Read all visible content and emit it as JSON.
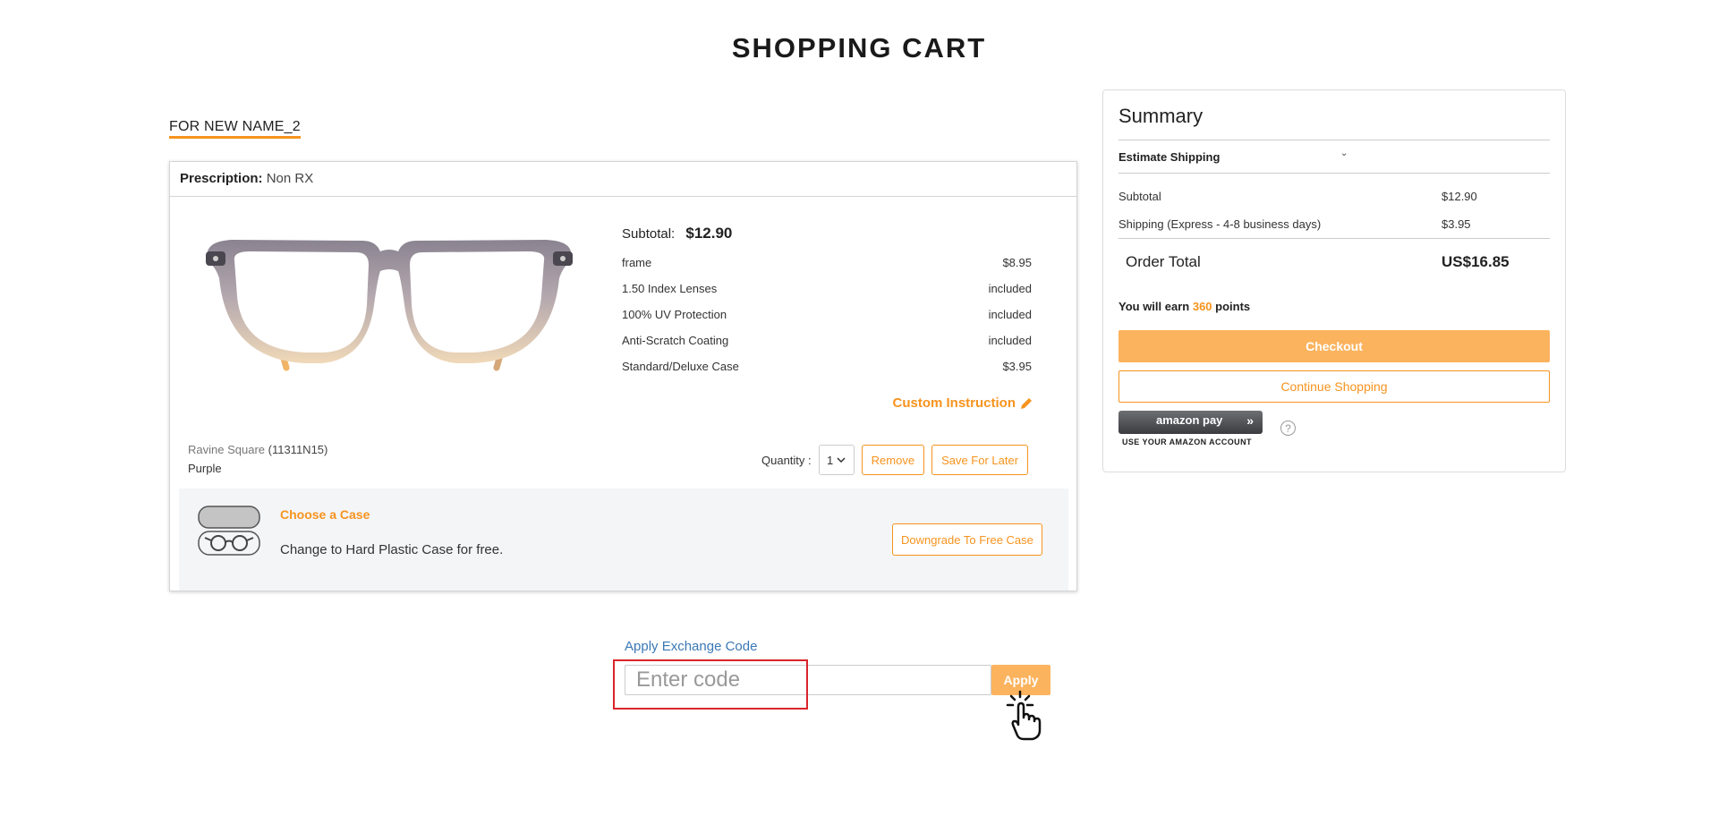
{
  "page": {
    "title": "SHOPPING CART"
  },
  "recipient": "FOR NEW NAME_2",
  "item": {
    "prescription_label": "Prescription:",
    "prescription_value": "Non RX",
    "name": "Ravine Square",
    "sku": "(11311N15)",
    "color": "Purple",
    "subtotal_label": "Subtotal:",
    "subtotal_value": "$12.90",
    "lines": [
      {
        "label": "frame",
        "value": "$8.95"
      },
      {
        "label": "1.50 Index Lenses",
        "value": "included"
      },
      {
        "label": "100% UV Protection",
        "value": "included"
      },
      {
        "label": "Anti-Scratch Coating",
        "value": "included"
      },
      {
        "label": "Standard/Deluxe Case",
        "value": "$3.95"
      }
    ],
    "custom_instruction": "Custom Instruction",
    "quantity_label": "Quantity :",
    "quantity_value": "1",
    "remove_label": "Remove",
    "save_later_label": "Save For Later"
  },
  "case": {
    "title": "Choose a Case",
    "description": "Change to Hard Plastic Case for free.",
    "button": "Downgrade To Free Case"
  },
  "summary": {
    "title": "Summary",
    "estimate_shipping": "Estimate Shipping",
    "subtotal_label": "Subtotal",
    "subtotal_value": "$12.90",
    "shipping_label": "Shipping (Express - 4-8 business days)",
    "shipping_value": "$3.95",
    "total_label": "Order Total",
    "total_value": "US$16.85",
    "points_prefix": "You will earn",
    "points_value": "360",
    "points_suffix": "points",
    "checkout": "Checkout",
    "continue": "Continue Shopping",
    "amazon_logo": "amazon pay",
    "amazon_sub": "USE YOUR AMAZON ACCOUNT",
    "help": "?"
  },
  "exchange": {
    "label": "Apply Exchange Code",
    "placeholder": "Enter code",
    "apply": "Apply"
  },
  "colors": {
    "accent": "#f7931e",
    "button_fill": "#fbb35e",
    "link": "#3a78b5",
    "focus": "#d9242b"
  }
}
